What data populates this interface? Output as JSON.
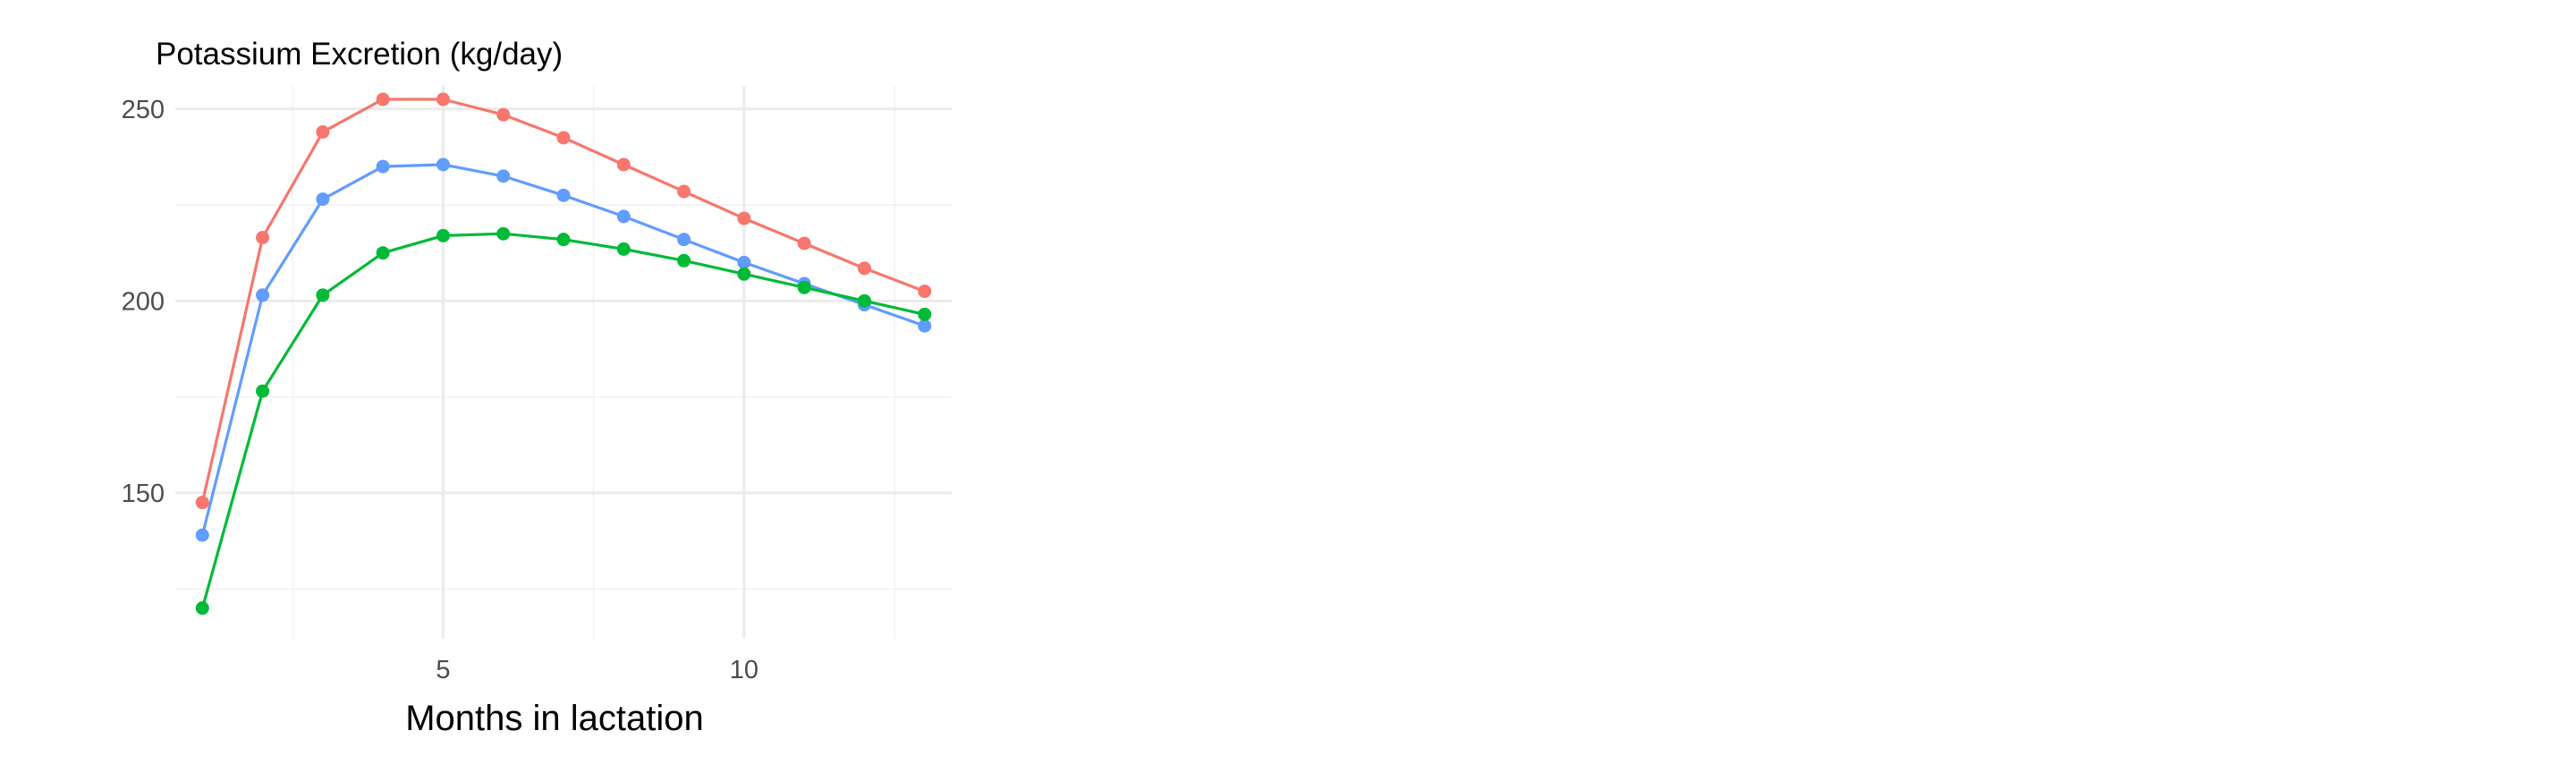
{
  "chart_data": {
    "type": "line",
    "title": "Potassium Excretion (kg/day)",
    "xlabel": "Months in lactation",
    "ylabel": "",
    "xlim": [
      0.55,
      13.45
    ],
    "ylim": [
      112,
      256
    ],
    "x_ticks": [
      5,
      10
    ],
    "x_tick_labels": [
      "5",
      "10"
    ],
    "x_minor_ticks": [
      2.5,
      7.5,
      12.5
    ],
    "y_ticks": [
      150,
      200,
      250
    ],
    "y_tick_labels": [
      "150",
      "200",
      "250"
    ],
    "y_minor_ticks": [
      125,
      175,
      225
    ],
    "grid": true,
    "legend": "none",
    "x": [
      1,
      2,
      3,
      4,
      5,
      6,
      7,
      8,
      9,
      10,
      11,
      12,
      13
    ],
    "series": [
      {
        "color": "#F8766D",
        "values": [
          147.5,
          216.5,
          244,
          252.5,
          252.5,
          248.5,
          242.5,
          235.5,
          228.5,
          221.5,
          215,
          208.5,
          202.5
        ]
      },
      {
        "color": "#619CFF",
        "values": [
          139,
          201.5,
          226.5,
          235,
          235.5,
          232.5,
          227.5,
          222,
          216,
          210,
          204.5,
          199,
          193.5
        ]
      },
      {
        "color": "#00BA38",
        "values": [
          120,
          176.5,
          201.5,
          212.5,
          217,
          217.5,
          216,
          213.5,
          210.5,
          207,
          203.5,
          200,
          196.5
        ]
      }
    ]
  }
}
